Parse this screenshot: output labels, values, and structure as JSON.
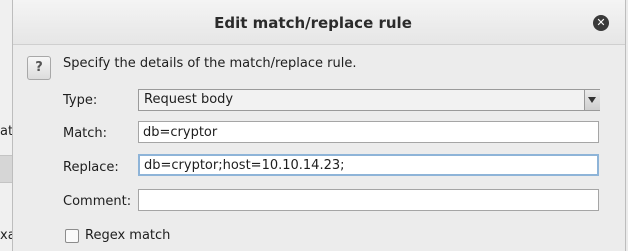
{
  "background": {
    "partial_text_1": "atch",
    "partial_text_2": "xa"
  },
  "dialog": {
    "title": "Edit match/replace rule",
    "close_icon": "close-icon",
    "help_label": "?",
    "description": "Specify the details of the match/replace rule."
  },
  "form": {
    "type": {
      "label": "Type:",
      "value": "Request body"
    },
    "match": {
      "label": "Match:",
      "value": "db=cryptor"
    },
    "replace": {
      "label": "Replace:",
      "value": "db=cryptor;host=10.10.14.23;"
    },
    "comment": {
      "label": "Comment:",
      "value": ""
    },
    "regex": {
      "label": "Regex match",
      "checked": false
    }
  },
  "colors": {
    "dialog_bg": "#ececec",
    "focus_border": "#8eb4d8"
  }
}
